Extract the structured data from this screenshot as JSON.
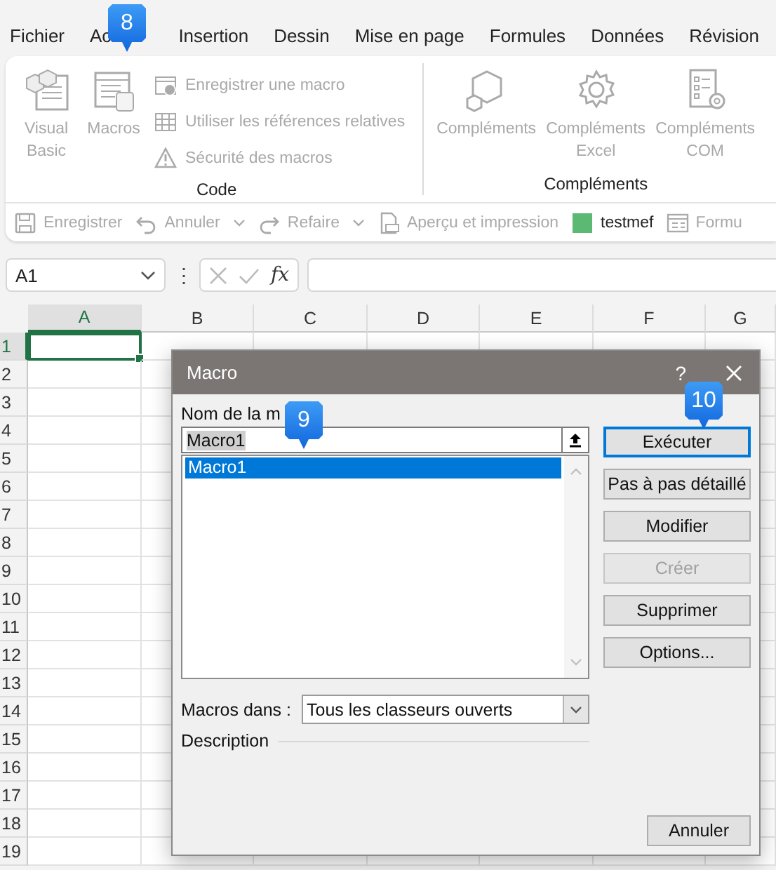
{
  "menu_tabs": [
    {
      "label": "Fichier"
    },
    {
      "label": "Ac"
    },
    {
      "label": "Insertion"
    },
    {
      "label": "Dessin"
    },
    {
      "label": "Mise en page"
    },
    {
      "label": "Formules"
    },
    {
      "label": "Données"
    },
    {
      "label": "Révision"
    }
  ],
  "ribbon": {
    "groups": [
      {
        "label": "Code",
        "items": [
          {
            "kind": "large",
            "label": "Visual Basic",
            "disabled": true
          },
          {
            "kind": "large",
            "label": "Macros",
            "disabled": true
          },
          {
            "kind": "small",
            "label": "Enregistrer une macro",
            "disabled": true
          },
          {
            "kind": "small",
            "label": "Utiliser les références relatives",
            "disabled": true
          },
          {
            "kind": "small",
            "label": "Sécurité des macros",
            "disabled": true
          }
        ]
      },
      {
        "label": "Compléments",
        "items": [
          {
            "kind": "large",
            "label": "Compléments",
            "disabled": true
          },
          {
            "kind": "large",
            "label": "Compléments Excel",
            "disabled": true
          },
          {
            "kind": "large",
            "label": "Compléments COM",
            "disabled": true
          }
        ]
      }
    ]
  },
  "quick_access": [
    {
      "kind": "button",
      "label": "Enregistrer",
      "disabled": true
    },
    {
      "kind": "split",
      "label": "Annuler",
      "disabled": true
    },
    {
      "kind": "split",
      "label": "Refaire",
      "disabled": true
    },
    {
      "kind": "button",
      "label": "Aperçu et impression",
      "disabled": true
    },
    {
      "kind": "swatch",
      "label": "testmef",
      "disabled": false
    },
    {
      "kind": "button",
      "label": "Formu",
      "disabled": true
    }
  ],
  "formula_bar": {
    "name_box": "A1",
    "more": "⋮",
    "function_label": "fx"
  },
  "grid": {
    "columns": [
      {
        "label": "A",
        "selected": true
      },
      {
        "label": "B",
        "selected": false
      },
      {
        "label": "C",
        "selected": false
      },
      {
        "label": "D",
        "selected": false
      },
      {
        "label": "E",
        "selected": false
      },
      {
        "label": "F",
        "selected": false
      },
      {
        "label": "G",
        "selected": false
      }
    ],
    "rows": [
      {
        "label": "1",
        "selected": true
      },
      {
        "label": "2",
        "selected": false
      },
      {
        "label": "3",
        "selected": false
      },
      {
        "label": "4",
        "selected": false
      },
      {
        "label": "5",
        "selected": false
      },
      {
        "label": "6",
        "selected": false
      },
      {
        "label": "7",
        "selected": false
      },
      {
        "label": "8",
        "selected": false
      },
      {
        "label": "9",
        "selected": false
      },
      {
        "label": "10",
        "selected": false
      },
      {
        "label": "11",
        "selected": false
      },
      {
        "label": "12",
        "selected": false
      },
      {
        "label": "13",
        "selected": false
      },
      {
        "label": "14",
        "selected": false
      },
      {
        "label": "15",
        "selected": false
      },
      {
        "label": "16",
        "selected": false
      },
      {
        "label": "17",
        "selected": false
      },
      {
        "label": "18",
        "selected": false
      },
      {
        "label": "19",
        "selected": false
      }
    ]
  },
  "dialog": {
    "title": "Macro",
    "help": "?",
    "name_label": "Nom de la m",
    "name_value": "Macro1",
    "macros": [
      {
        "label": "Macro1",
        "selected": true
      }
    ],
    "buttons": [
      {
        "label": "Exécuter",
        "default": true,
        "disabled": false
      },
      {
        "label": "Pas à pas détaillé",
        "default": false,
        "disabled": false
      },
      {
        "label": "Modifier",
        "default": false,
        "disabled": false
      },
      {
        "label": "Créer",
        "default": false,
        "disabled": true
      },
      {
        "label": "Supprimer",
        "default": false,
        "disabled": false
      },
      {
        "label": "Options...",
        "default": false,
        "disabled": false
      }
    ],
    "macros_in_label": "Macros dans :",
    "macros_in_value": "Tous les classeurs ouverts",
    "description_label": "Description",
    "cancel": "Annuler"
  },
  "callouts": [
    {
      "label": "8"
    },
    {
      "label": "9"
    },
    {
      "label": "10"
    }
  ]
}
